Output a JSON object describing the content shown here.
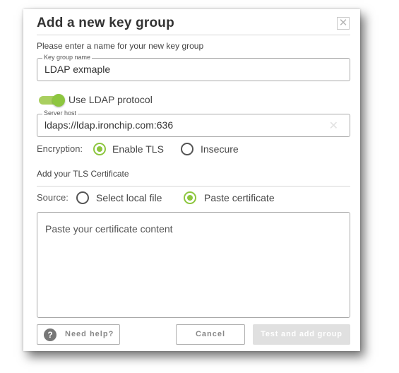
{
  "dialog": {
    "title": "Add a new key group",
    "close_glyph": "✕",
    "close_icon": "close-icon",
    "name_prompt": "Please enter a name for your new key group",
    "key_group_name": {
      "legend": "Key group name",
      "value": "LDAP exmaple"
    },
    "ldap_toggle": {
      "label": "Use LDAP protocol",
      "on": true,
      "color": "#8dc63f"
    },
    "server_host": {
      "legend": "Server host",
      "value": "ldaps://ldap.ironchip.com:636",
      "clear_glyph": "✕"
    },
    "encryption": {
      "label": "Encryption:",
      "options": [
        {
          "label": "Enable TLS",
          "selected": true
        },
        {
          "label": "Insecure",
          "selected": false
        }
      ]
    },
    "tls_section_title": "Add your TLS Certificate",
    "source": {
      "label": "Source:",
      "options": [
        {
          "label": "Select local file",
          "selected": false
        },
        {
          "label": "Paste certificate",
          "selected": true
        }
      ]
    },
    "certificate": {
      "placeholder": "Paste your certificate content",
      "value": ""
    },
    "buttons": {
      "help_glyph": "?",
      "help": "Need help?",
      "cancel": "Cancel",
      "submit": "Test and add group"
    },
    "accent_color": "#8dc63f"
  }
}
